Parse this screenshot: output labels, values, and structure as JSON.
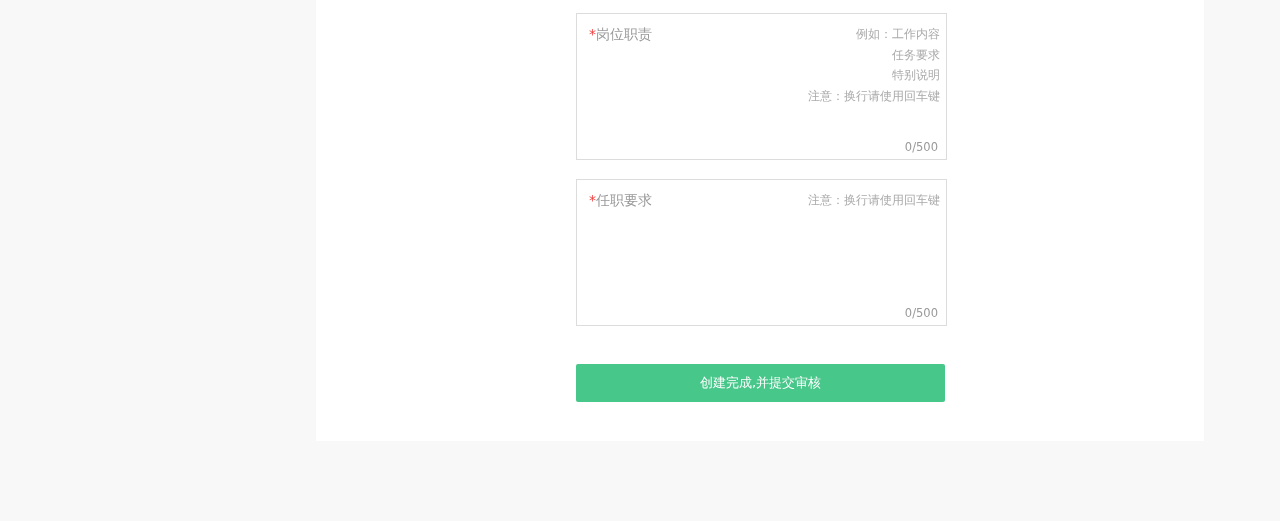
{
  "fields": [
    {
      "required_mark": "*",
      "label": "岗位职责",
      "hint_lines": [
        "例如：工作内容",
        "任务要求",
        "特别说明",
        "注意：换行请使用回车键"
      ],
      "counter": "0/500"
    },
    {
      "required_mark": "*",
      "label": "任职要求",
      "hint_lines": [
        "注意：换行请使用回车键"
      ],
      "counter": "0/500"
    }
  ],
  "submit_button": "创建完成,并提交审核"
}
